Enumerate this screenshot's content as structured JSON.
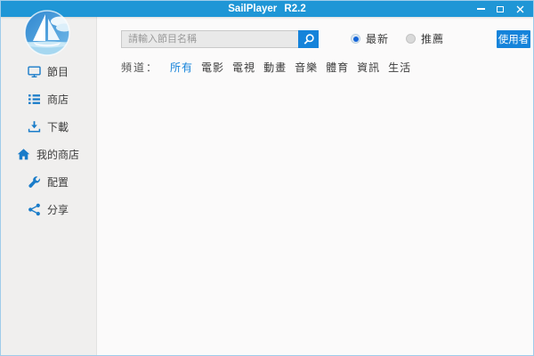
{
  "window": {
    "title": "SailPlayer R2.2",
    "controls": [
      {
        "name": "minimize",
        "icon": "minimize-icon"
      },
      {
        "name": "maximize",
        "icon": "maximize-icon"
      },
      {
        "name": "close",
        "icon": "close-icon"
      }
    ]
  },
  "sidebar": {
    "logo_icon": "sailboat-logo",
    "items": [
      {
        "label": "節目",
        "icon": "monitor-icon"
      },
      {
        "label": "商店",
        "icon": "list-icon"
      },
      {
        "label": "下載",
        "icon": "download-icon"
      },
      {
        "label": "我的商店",
        "icon": "home-icon"
      },
      {
        "label": "配置",
        "icon": "wrench-icon"
      },
      {
        "label": "分享",
        "icon": "share-icon"
      }
    ]
  },
  "toolbar": {
    "search_placeholder": "請輸入節目名稱",
    "search_icon": "magnifier-icon",
    "sort_options": [
      {
        "label": "最新",
        "selected": true
      },
      {
        "label": "推薦",
        "selected": false
      }
    ],
    "user_button": "使用者"
  },
  "channels": {
    "label": "頻道：",
    "items": [
      {
        "label": "所有",
        "active": true
      },
      {
        "label": "電影",
        "active": false
      },
      {
        "label": "電視",
        "active": false
      },
      {
        "label": "動畫",
        "active": false
      },
      {
        "label": "音樂",
        "active": false
      },
      {
        "label": "體育",
        "active": false
      },
      {
        "label": "資訊",
        "active": false
      },
      {
        "label": "生活",
        "active": false
      }
    ]
  },
  "colors": {
    "titlebar": "#1f96d6",
    "accent": "#1583da",
    "icon_blue": "#1a7cc9",
    "sidebar_bg": "#f0efee",
    "main_bg": "#fbfafa"
  }
}
